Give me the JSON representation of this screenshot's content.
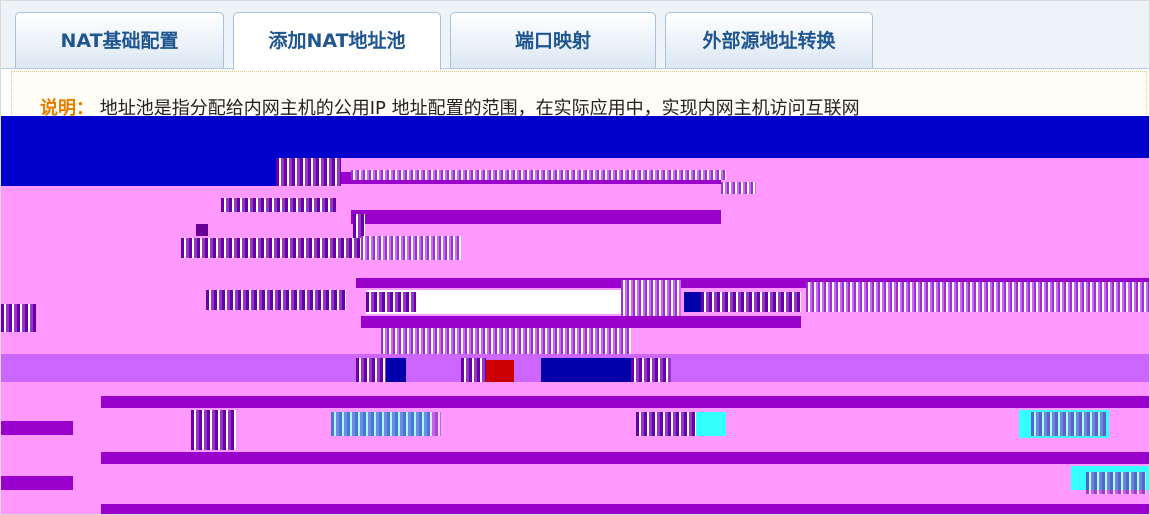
{
  "tabs": [
    {
      "label": "NAT基础配置",
      "active": false
    },
    {
      "label": "添加NAT地址池",
      "active": true
    },
    {
      "label": "端口映射",
      "active": false
    },
    {
      "label": "外部源地址转换",
      "active": false
    }
  ],
  "notice": {
    "key": "说明：",
    "text": "地址池是指分配给内网主机的公用IP 地址配置的范围，在实际应用中，实现内网主机访问互联网"
  },
  "colors": {
    "tab_text": "#1f5690",
    "notice_key": "#e67e00",
    "glitch_background": "#ff99ff",
    "glitch_blue": "#0000cc"
  }
}
